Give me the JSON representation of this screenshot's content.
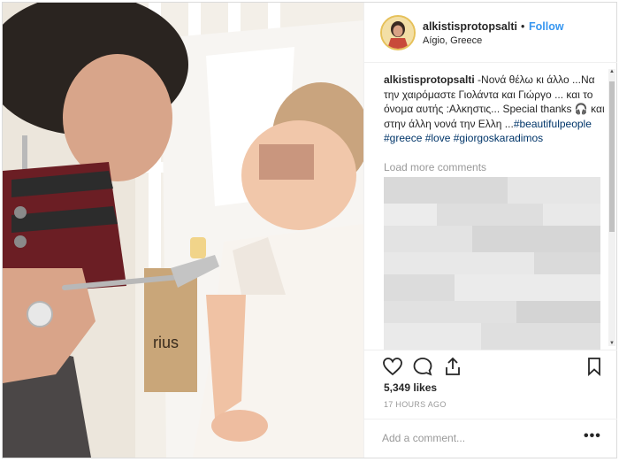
{
  "post": {
    "username": "alkistisprotopsalti",
    "separator": "•",
    "follow_label": "Follow",
    "location": "Aígio, Greece"
  },
  "caption": {
    "username": "alkistisprotopsalti",
    "text": " -Νονά θέλω κι άλλο ...Να την χαιρόμαστε Γιολάντα και Γιώργο ... και το όνομα αυτής :Αλκηστις... Special thanks 🎧 και στην άλλη νονά την Ελλη ...",
    "hashtags": [
      "#beautifulpeople",
      "#greece",
      "#love",
      "#giorgoskaradimos"
    ]
  },
  "comments": {
    "load_more_label": "Load more comments"
  },
  "stats": {
    "likes": "5,349 likes",
    "timestamp": "17 HOURS AGO"
  },
  "add_comment": {
    "placeholder": "Add a comment...",
    "more_label": "•••"
  },
  "icons": [
    "heart-icon",
    "comment-icon",
    "share-icon",
    "bookmark-icon",
    "more-options-icon"
  ],
  "colors": {
    "link_blue": "#3897f0",
    "hashtag_blue": "#003569",
    "muted": "#999999",
    "text": "#262626"
  }
}
